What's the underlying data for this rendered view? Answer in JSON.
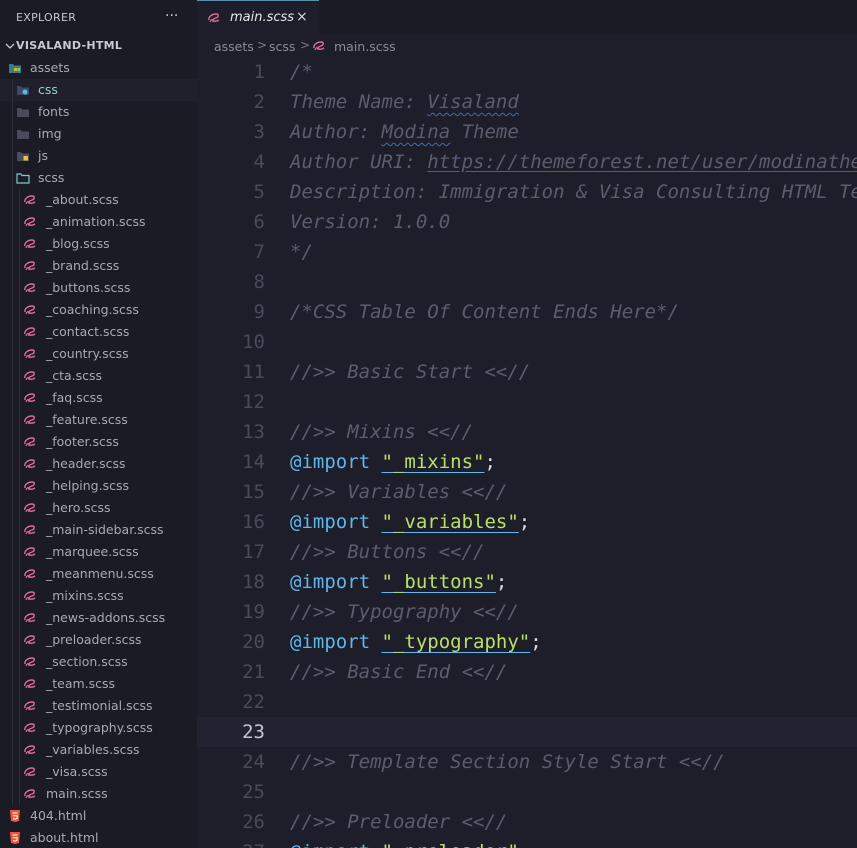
{
  "sidebar": {
    "title": "EXPLORER",
    "more": "···",
    "project": "VISALAND-HTML",
    "items": [
      {
        "label": "assets",
        "type": "folder-open-special",
        "depth": 0
      },
      {
        "label": "css",
        "type": "folder-special",
        "depth": 1,
        "active": true
      },
      {
        "label": "fonts",
        "type": "folder",
        "depth": 1
      },
      {
        "label": "img",
        "type": "folder",
        "depth": 1
      },
      {
        "label": "js",
        "type": "folder-js",
        "depth": 1
      },
      {
        "label": "scss",
        "type": "folder-open",
        "depth": 1
      },
      {
        "label": "_about.scss",
        "type": "sass",
        "depth": 2
      },
      {
        "label": "_animation.scss",
        "type": "sass",
        "depth": 2
      },
      {
        "label": "_blog.scss",
        "type": "sass",
        "depth": 2
      },
      {
        "label": "_brand.scss",
        "type": "sass",
        "depth": 2
      },
      {
        "label": "_buttons.scss",
        "type": "sass",
        "depth": 2
      },
      {
        "label": "_coaching.scss",
        "type": "sass",
        "depth": 2
      },
      {
        "label": "_contact.scss",
        "type": "sass",
        "depth": 2
      },
      {
        "label": "_country.scss",
        "type": "sass",
        "depth": 2
      },
      {
        "label": "_cta.scss",
        "type": "sass",
        "depth": 2
      },
      {
        "label": "_faq.scss",
        "type": "sass",
        "depth": 2
      },
      {
        "label": "_feature.scss",
        "type": "sass",
        "depth": 2
      },
      {
        "label": "_footer.scss",
        "type": "sass",
        "depth": 2
      },
      {
        "label": "_header.scss",
        "type": "sass",
        "depth": 2
      },
      {
        "label": "_helping.scss",
        "type": "sass",
        "depth": 2
      },
      {
        "label": "_hero.scss",
        "type": "sass",
        "depth": 2
      },
      {
        "label": "_main-sidebar.scss",
        "type": "sass",
        "depth": 2
      },
      {
        "label": "_marquee.scss",
        "type": "sass",
        "depth": 2
      },
      {
        "label": "_meanmenu.scss",
        "type": "sass",
        "depth": 2
      },
      {
        "label": "_mixins.scss",
        "type": "sass",
        "depth": 2
      },
      {
        "label": "_news-addons.scss",
        "type": "sass",
        "depth": 2
      },
      {
        "label": "_preloader.scss",
        "type": "sass",
        "depth": 2
      },
      {
        "label": "_section.scss",
        "type": "sass",
        "depth": 2
      },
      {
        "label": "_team.scss",
        "type": "sass",
        "depth": 2
      },
      {
        "label": "_testimonial.scss",
        "type": "sass",
        "depth": 2
      },
      {
        "label": "_typography.scss",
        "type": "sass",
        "depth": 2
      },
      {
        "label": "_variables.scss",
        "type": "sass",
        "depth": 2
      },
      {
        "label": "_visa.scss",
        "type": "sass",
        "depth": 2
      },
      {
        "label": "main.scss",
        "type": "sass",
        "depth": 2
      },
      {
        "label": "404.html",
        "type": "html",
        "depth": 0
      },
      {
        "label": "about.html",
        "type": "html",
        "depth": 0
      }
    ]
  },
  "tab": {
    "label": "main.scss",
    "close": "×"
  },
  "breadcrumb": {
    "parts": [
      "assets",
      "scss",
      "main.scss"
    ],
    "sep": ">"
  },
  "editor": {
    "current_line": 23,
    "lines": [
      {
        "n": "1",
        "t": "/*"
      },
      {
        "n": "2",
        "t": "Theme Name: Visaland"
      },
      {
        "n": "3",
        "t": "Author: Modina Theme"
      },
      {
        "n": "4",
        "t": "Author URI: https://themeforest.net/user/modinatheme/"
      },
      {
        "n": "5",
        "t": "Description: Immigration & Visa Consulting HTML Template"
      },
      {
        "n": "6",
        "t": "Version: 1.0.0"
      },
      {
        "n": "7",
        "t": "*/"
      },
      {
        "n": "8",
        "t": ""
      },
      {
        "n": "9",
        "t": "/*CSS Table Of Content Ends Here*/"
      },
      {
        "n": "10",
        "t": ""
      },
      {
        "n": "11",
        "t": "//>> Basic Start <<//"
      },
      {
        "n": "12",
        "t": ""
      },
      {
        "n": "13",
        "t": "//>> Mixins <<//"
      },
      {
        "n": "14",
        "t": "@import \"_mixins\";",
        "import": "\"_mixins\""
      },
      {
        "n": "15",
        "t": "//>> Variables <<//"
      },
      {
        "n": "16",
        "t": "@import \"_variables\";",
        "import": "\"_variables\""
      },
      {
        "n": "17",
        "t": "//>> Buttons <<//"
      },
      {
        "n": "18",
        "t": "@import \"_buttons\";",
        "import": "\"_buttons\""
      },
      {
        "n": "19",
        "t": "//>> Typography <<//"
      },
      {
        "n": "20",
        "t": "@import \"_typography\";",
        "import": "\"_typography\""
      },
      {
        "n": "21",
        "t": "//>> Basic End <<//"
      },
      {
        "n": "22",
        "t": ""
      },
      {
        "n": "23",
        "t": ""
      },
      {
        "n": "24",
        "t": "//>> Template Section Style Start <<//"
      },
      {
        "n": "25",
        "t": ""
      },
      {
        "n": "26",
        "t": "//>> Preloader <<//"
      },
      {
        "n": "27",
        "t": "@import \"_preloader\";",
        "import": "\"_preloader\""
      }
    ]
  },
  "colors": {
    "background": "#1e1e2a",
    "sidebar": "#1b1b25",
    "comment": "#5a5d6e",
    "keyword": "#5fb7ea",
    "string": "#b8e06b",
    "sass": "#e06c96",
    "html": "#e8553a"
  }
}
